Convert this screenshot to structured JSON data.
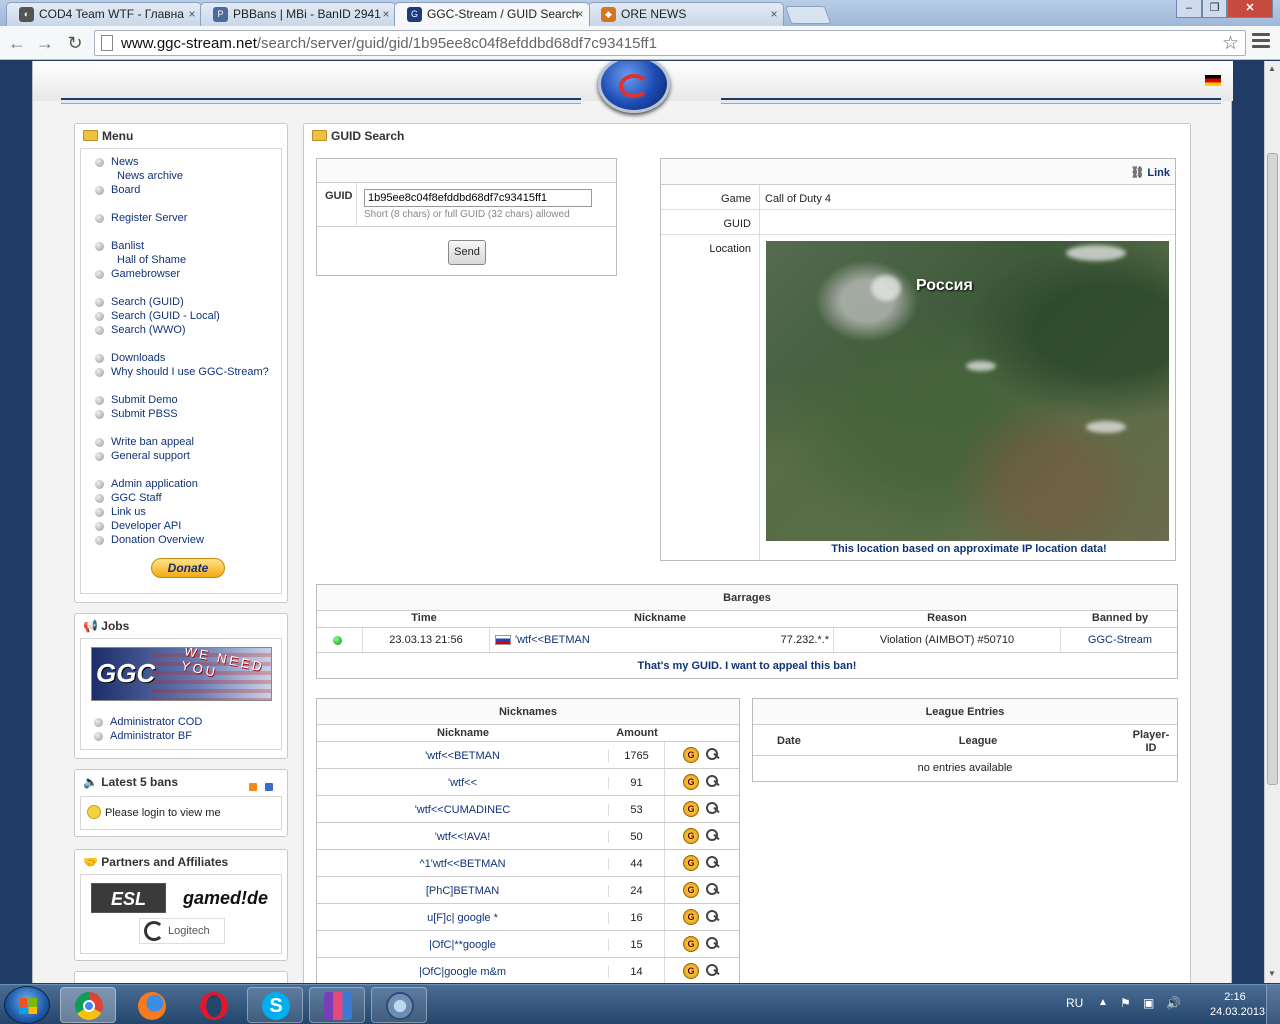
{
  "browser": {
    "tabs": [
      {
        "title": "COD4 Team WTF - Главна",
        "favicon": "cod4-icon"
      },
      {
        "title": "PBBans | MBi - BanID 2941",
        "favicon": "pbbans-icon"
      },
      {
        "title": "GGC-Stream / GUID Search",
        "favicon": "ggc-icon"
      },
      {
        "title": "ORE NEWS",
        "favicon": "ore-icon"
      }
    ],
    "url_domain": "www.ggc-stream.net",
    "url_path": "/search/server/guid/gid/1b95ee8c04f8efddbd68df7c93415ff1"
  },
  "menu": {
    "title": "Menu",
    "groups": [
      [
        {
          "label": "News",
          "sub": false
        },
        {
          "label": "News archive",
          "sub": true
        },
        {
          "label": "Board",
          "sub": false
        }
      ],
      [
        {
          "label": "Register Server",
          "sub": false
        }
      ],
      [
        {
          "label": "Banlist",
          "sub": false
        },
        {
          "label": "Hall of Shame",
          "sub": true
        },
        {
          "label": "Gamebrowser",
          "sub": false
        }
      ],
      [
        {
          "label": "Search (GUID)",
          "sub": false
        },
        {
          "label": "Search (GUID - Local)",
          "sub": false
        },
        {
          "label": "Search (WWO)",
          "sub": false
        }
      ],
      [
        {
          "label": "Downloads",
          "sub": false
        },
        {
          "label": "Why should I use GGC-Stream?",
          "sub": false
        }
      ],
      [
        {
          "label": "Submit Demo",
          "sub": false
        },
        {
          "label": "Submit PBSS",
          "sub": false
        }
      ],
      [
        {
          "label": "Write ban appeal",
          "sub": false
        },
        {
          "label": "General support",
          "sub": false
        }
      ],
      [
        {
          "label": "Admin application",
          "sub": false
        },
        {
          "label": "GGC Staff",
          "sub": false
        },
        {
          "label": "Link us",
          "sub": false
        },
        {
          "label": "Developer API",
          "sub": false
        },
        {
          "label": "Donation Overview",
          "sub": false
        }
      ]
    ],
    "donate": "Donate"
  },
  "jobs": {
    "title": "Jobs",
    "banner_logo": "GGC",
    "banner_text": "WE NEED YOU",
    "items": [
      "Administrator COD",
      "Administrator BF"
    ]
  },
  "latest": {
    "title": "Latest 5 bans",
    "message": "Please login to view me"
  },
  "partners": {
    "title": "Partners and Affiliates",
    "logos": [
      "ESL",
      "gamed!de",
      "Logitech"
    ]
  },
  "guid_search": {
    "title": "GUID Search",
    "label": "GUID",
    "value": "1b95ee8c04f8efddbd68df7c93415ff1",
    "hint": "Short (8 chars) or full GUID (32 chars) allowed",
    "send": "Send"
  },
  "info": {
    "link": "Link",
    "game_label": "Game",
    "game_value": "Call of Duty 4",
    "guid_label": "GUID",
    "location_label": "Location",
    "map_text": "Россия",
    "location_note": "This location based on approximate IP location data!"
  },
  "barrages": {
    "title": "Barrages",
    "headers": [
      "Time",
      "Nickname",
      "Reason",
      "Banned by"
    ],
    "rows": [
      {
        "time": "23.03.13 21:56",
        "nickname": "'wtf<<BETMAN",
        "ip": "77.232.*.*",
        "reason": "Violation (AIMBOT) #50710",
        "banned_by": "GGC-Stream",
        "status": "green"
      }
    ],
    "appeal": "That's my GUID. I want to appeal this ban!"
  },
  "nicknames": {
    "title": "Nicknames",
    "headers": [
      "Nickname",
      "Amount"
    ],
    "rows": [
      {
        "nick": "'wtf<<BETMAN",
        "amount": "1765"
      },
      {
        "nick": "'wtf<<",
        "amount": "91"
      },
      {
        "nick": "'wtf<<CUMADINEC",
        "amount": "53"
      },
      {
        "nick": "'wtf<<!AVA!",
        "amount": "50"
      },
      {
        "nick": "^1'wtf<<BETMAN",
        "amount": "44"
      },
      {
        "nick": "[PhC]BETMAN",
        "amount": "24"
      },
      {
        "nick": "u[F]c| google *",
        "amount": "16"
      },
      {
        "nick": "|OfC|**google",
        "amount": "15"
      },
      {
        "nick": "|OfC|google m&m",
        "amount": "14"
      }
    ]
  },
  "league": {
    "title": "League Entries",
    "headers": [
      "Date",
      "League",
      "Player-ID"
    ],
    "empty": "no entries available"
  },
  "taskbar": {
    "apps": [
      "chrome",
      "firefox",
      "opera",
      "skype",
      "winrar",
      "teamspeak"
    ],
    "lang": "RU",
    "time": "2:16",
    "date": "24.03.2013"
  },
  "colors": {
    "accent_blue": "#1f3b66",
    "link": "#11337a"
  }
}
